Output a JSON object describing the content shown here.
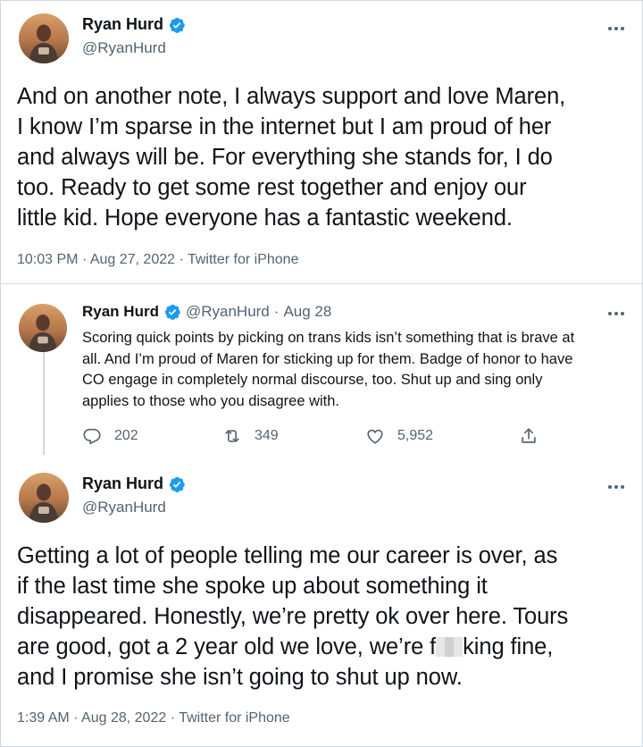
{
  "tweet1": {
    "author_name": "Ryan Hurd",
    "handle": "@RyanHurd",
    "text_lines": [
      "And on another note, I always support and love Maren,",
      "I know I’m sparse in the internet but I am proud of her",
      "and always will be. For everything she stands for, I do",
      "too. Ready to get some rest together and enjoy our",
      "little kid. Hope everyone has a fantastic weekend."
    ],
    "time": "10:03 PM",
    "date": "Aug 27, 2022",
    "source": "Twitter for iPhone",
    "dot": "·"
  },
  "tweet2": {
    "author_name": "Ryan Hurd",
    "handle": "@RyanHurd",
    "date": "Aug 28",
    "dot": "·",
    "text_lines": [
      "Scoring quick points by picking on trans kids isn’t something that is brave at",
      "all. And I’m proud of Maren for sticking up for them. Badge of honor to have",
      "CO engage in completely normal discourse, too. Shut up and sing only",
      "applies to those who you disagree with."
    ],
    "replies": "202",
    "retweets": "349",
    "likes": "5,952"
  },
  "tweet3": {
    "author_name": "Ryan Hurd",
    "handle": "@RyanHurd",
    "text_lines_before": [
      "Getting a lot of people telling me our career is over, as",
      "if the last time she spoke up about something it",
      "disappeared. Honestly, we’re pretty ok over here. Tours"
    ],
    "line4_prefix": "are good, got a 2 year old we love, we’re f",
    "line4_suffix": "king fine,",
    "line5": "and I promise she isn’t going to shut up now.",
    "time": "1:39 AM",
    "date": "Aug 28, 2022",
    "source": "Twitter for iPhone",
    "dot": "·"
  },
  "icons": {
    "verified": "verified-badge-icon",
    "more": "more-options-icon",
    "reply": "reply-icon",
    "retweet": "retweet-icon",
    "like": "like-icon",
    "share": "share-icon"
  },
  "colors": {
    "verified_blue": "#1d9bf0",
    "secondary_text": "#536471",
    "primary_text": "#0f1419",
    "border": "#cfd9de"
  }
}
